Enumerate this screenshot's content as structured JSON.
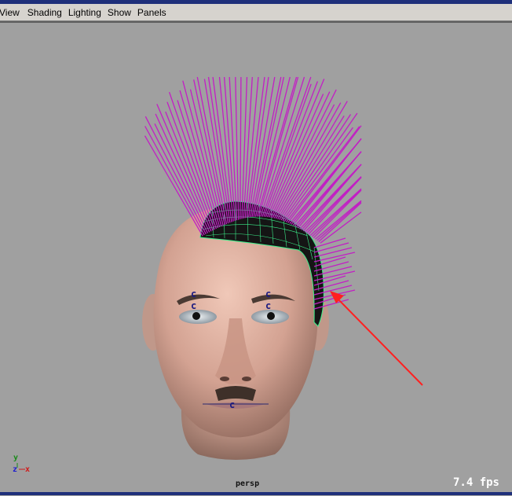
{
  "menu": {
    "items": [
      {
        "label": "View"
      },
      {
        "label": "Shading"
      },
      {
        "label": "Lighting"
      },
      {
        "label": "Show"
      },
      {
        "label": "Panels"
      }
    ]
  },
  "viewport": {
    "camera_label": "persp",
    "fps_value": "7.4",
    "fps_unit": "fps",
    "axis": {
      "y": "y",
      "z": "z",
      "x": "x"
    }
  },
  "colors": {
    "background": "#a0a0a0",
    "hair": "#c21ec4",
    "scalp_mesh": "#3cf08a",
    "arrow": "#ff2020",
    "skin": "#d8a898"
  },
  "icons": [
    "manipulator-c-icon",
    "annotation-arrow-icon",
    "axis-indicator-icon"
  ]
}
